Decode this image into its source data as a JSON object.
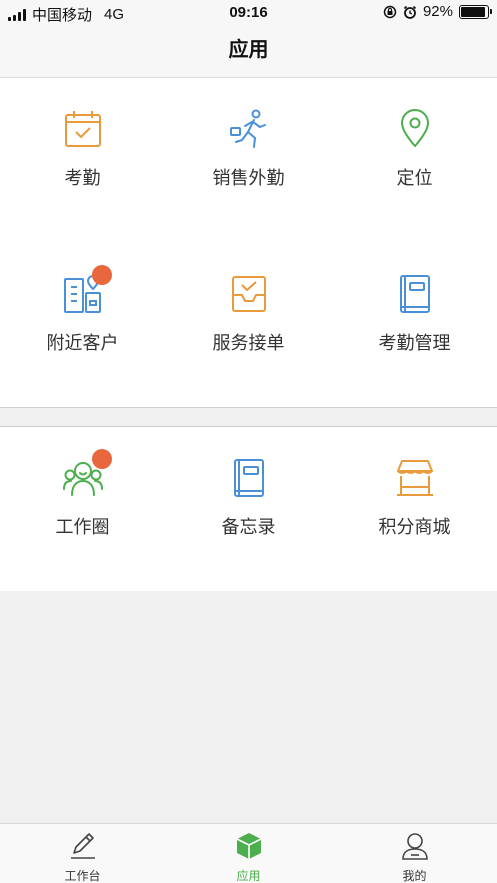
{
  "status_bar": {
    "carrier": "中国移动",
    "network": "4G",
    "time": "09:16",
    "battery": "92%",
    "battery_level": 0.92
  },
  "header": {
    "title": "应用"
  },
  "apps_section_1": [
    {
      "label": "考勤",
      "icon": "calendar-check-icon",
      "color": "#e89a3c"
    },
    {
      "label": "销售外勤",
      "icon": "running-person-icon",
      "color": "#4a90d9"
    },
    {
      "label": "定位",
      "icon": "location-pin-icon",
      "color": "#4cae4c"
    },
    {
      "label": "附近客户",
      "icon": "nearby-buildings-icon",
      "color": "#4a90d9",
      "badge": true
    },
    {
      "label": "服务接单",
      "icon": "inbox-check-icon",
      "color": "#e89a3c"
    },
    {
      "label": "考勤管理",
      "icon": "book-icon",
      "color": "#4a90d9"
    }
  ],
  "apps_section_2": [
    {
      "label": "工作圈",
      "icon": "people-group-icon",
      "color": "#4cae4c",
      "badge": true
    },
    {
      "label": "备忘录",
      "icon": "notebook-icon",
      "color": "#4a90d9"
    },
    {
      "label": "积分商城",
      "icon": "store-icon",
      "color": "#e89a3c"
    }
  ],
  "colors": {
    "accent_green": "#4cae4c",
    "badge_orange": "#e8673c"
  },
  "tab_bar": {
    "tabs": [
      {
        "label": "工作台",
        "icon": "pencil-icon"
      },
      {
        "label": "应用",
        "icon": "cube-icon",
        "active": true
      },
      {
        "label": "我的",
        "icon": "person-icon"
      }
    ]
  }
}
